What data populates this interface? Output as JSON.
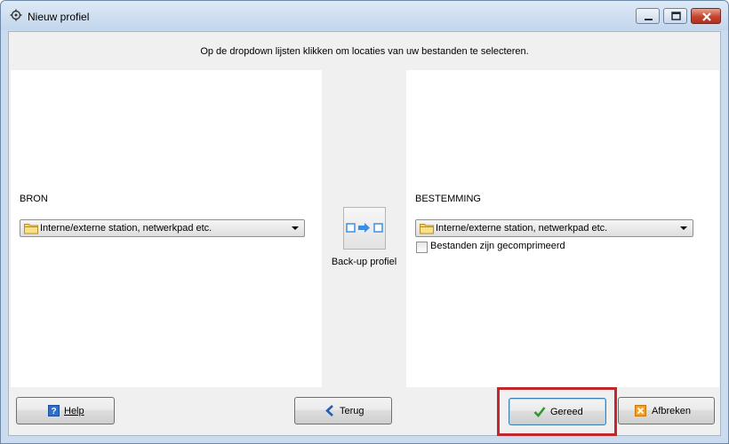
{
  "window": {
    "title": "Nieuw profiel"
  },
  "instruction": "Op de dropdown lijsten klikken om locaties van uw bestanden te selecteren.",
  "source": {
    "label": "BRON",
    "selected": "Interne/externe station, netwerkpad etc."
  },
  "middle": {
    "label": "Back-up profiel"
  },
  "destination": {
    "label": "BESTEMMING",
    "selected": "Interne/externe station, netwerkpad etc.",
    "compressed_label": "Bestanden zijn gecomprimeerd",
    "compressed_checked": false
  },
  "buttons": {
    "help": "Help",
    "back": "Terug",
    "done": "Gereed",
    "cancel": "Afbreken"
  },
  "colors": {
    "highlight": "#c1282d",
    "check": "#2e9a2e",
    "cancel_icon": "#f0a020",
    "help_icon": "#2f6fc9",
    "back_arrow": "#1f5fb8"
  }
}
